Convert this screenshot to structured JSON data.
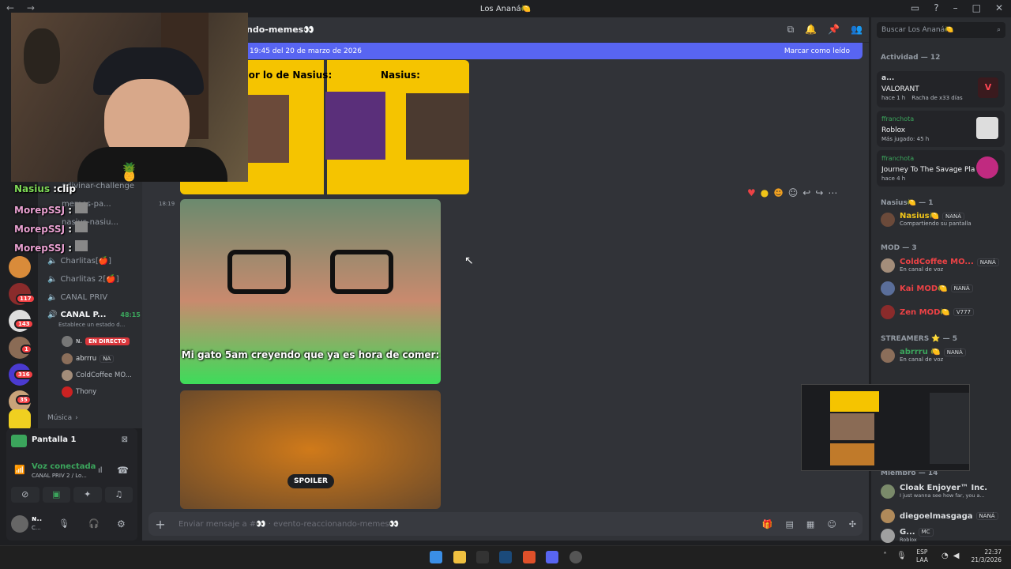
{
  "window": {
    "title": "Los Ananá🍋"
  },
  "channel_header": {
    "name": "ndo-memes👀"
  },
  "banner": {
    "text": "19:45 del 20 de marzo de 2026",
    "mark_read": "Marcar como leído"
  },
  "guilds": {
    "badges": [
      "1",
      "117",
      "143",
      "1",
      "316",
      "35"
    ]
  },
  "channels": {
    "items": [
      {
        "label": "adivinar-challenge"
      },
      {
        "label": "memes-pa..."
      },
      {
        "label": "nasius-nasiu..."
      },
      {
        "label": "Charlitas[🍎]"
      },
      {
        "label": "Charlitas 2[🍎]"
      },
      {
        "label": "CANAL PRIV"
      },
      {
        "label": "CANAL P...",
        "time": "48:15",
        "status": "Establece un estado d..."
      }
    ],
    "voice_users": [
      {
        "name": "ɴ.",
        "badge": "EN DIRECTO"
      },
      {
        "name": "abrrru",
        "badge": "NA"
      },
      {
        "name": "ColdCoffee MO..."
      },
      {
        "name": "Thony"
      }
    ],
    "category": "Música"
  },
  "panel": {
    "stream_title": "Pantalla 1",
    "voice_title": "Voz conectada",
    "voice_sub": "CANAL PRIV 2 / Lo...",
    "user": "ɴ..",
    "user_sub": "C..."
  },
  "message": {
    "time": "18:19",
    "meme1_left_caption": "por lo de Nasius:",
    "meme1_right_caption": "Nasius:",
    "meme2_caption": "Mi gato 5am creyendo que ya es hora de comer:",
    "spoiler": "SPOILER"
  },
  "input": {
    "placeholder": "Enviar mensaje a #👀 · evento-reaccionando-memes👀"
  },
  "members": {
    "search_placeholder": "Buscar Los Ananá🍋",
    "activity_header": "Actividad — 12",
    "activities": [
      {
        "user": "a...",
        "game": "VALORANT",
        "detail": "hace 1 h",
        "extra": "Racha de x33 días"
      },
      {
        "user": "ffranchota",
        "game": "Roblox",
        "detail": "Más jugado: 45 h"
      },
      {
        "user": "ffranchota",
        "game": "Journey To The Savage Pla...",
        "detail": "hace 4 h"
      }
    ],
    "groups": [
      {
        "header": "Nasius🍋 — 1",
        "members": [
          {
            "name": "Nasius🍋",
            "tag": "NANÁ",
            "status": "Compartiendo su pantalla",
            "color": "#f0c419"
          }
        ]
      },
      {
        "header": "MOD — 3",
        "members": [
          {
            "name": "ColdCoffee MO...",
            "tag": "NANÁ",
            "status": "En canal de voz",
            "color": "#ed4245"
          },
          {
            "name": "Kai MOD🍋",
            "tag": "NANÁ",
            "status": "",
            "color": "#ed4245"
          },
          {
            "name": "Zen MOD🍋",
            "tag": "V777",
            "status": "",
            "color": "#ed4245"
          }
        ]
      },
      {
        "header": "STREAMERS ⭐ — 5",
        "members": [
          {
            "name": "abrrru 🍋",
            "tag": "NANÁ",
            "status": "En canal de voz",
            "color": "#3ba55c"
          }
        ]
      },
      {
        "header": "Miembro — 14",
        "members": [
          {
            "name": "Cloak Enjoyer™ Inc.",
            "tag": "",
            "status": "I just wanna see how far, you a...",
            "color": "#dbdee1"
          },
          {
            "name": "diegoelmasgaga",
            "tag": "NANÁ",
            "status": "",
            "color": "#dbdee1"
          },
          {
            "name": "G...",
            "tag": "MC",
            "status": "Roblox",
            "color": "#dbdee1"
          }
        ]
      }
    ]
  },
  "stream_chat": [
    {
      "user": "Nasius",
      "text": ":clip",
      "color": "#7ed957"
    },
    {
      "user": "MorepSSJ",
      "text": ":",
      "color": "#e8a0d0"
    },
    {
      "user": "MorepSSJ",
      "text": ":",
      "color": "#e8a0d0"
    },
    {
      "user": "MorepSSJ",
      "text": ":",
      "color": "#e8a0d0"
    }
  ],
  "taskbar": {
    "lang": "ESP",
    "lang2": "LAA",
    "time": "22:37",
    "date": "21/3/2026"
  }
}
